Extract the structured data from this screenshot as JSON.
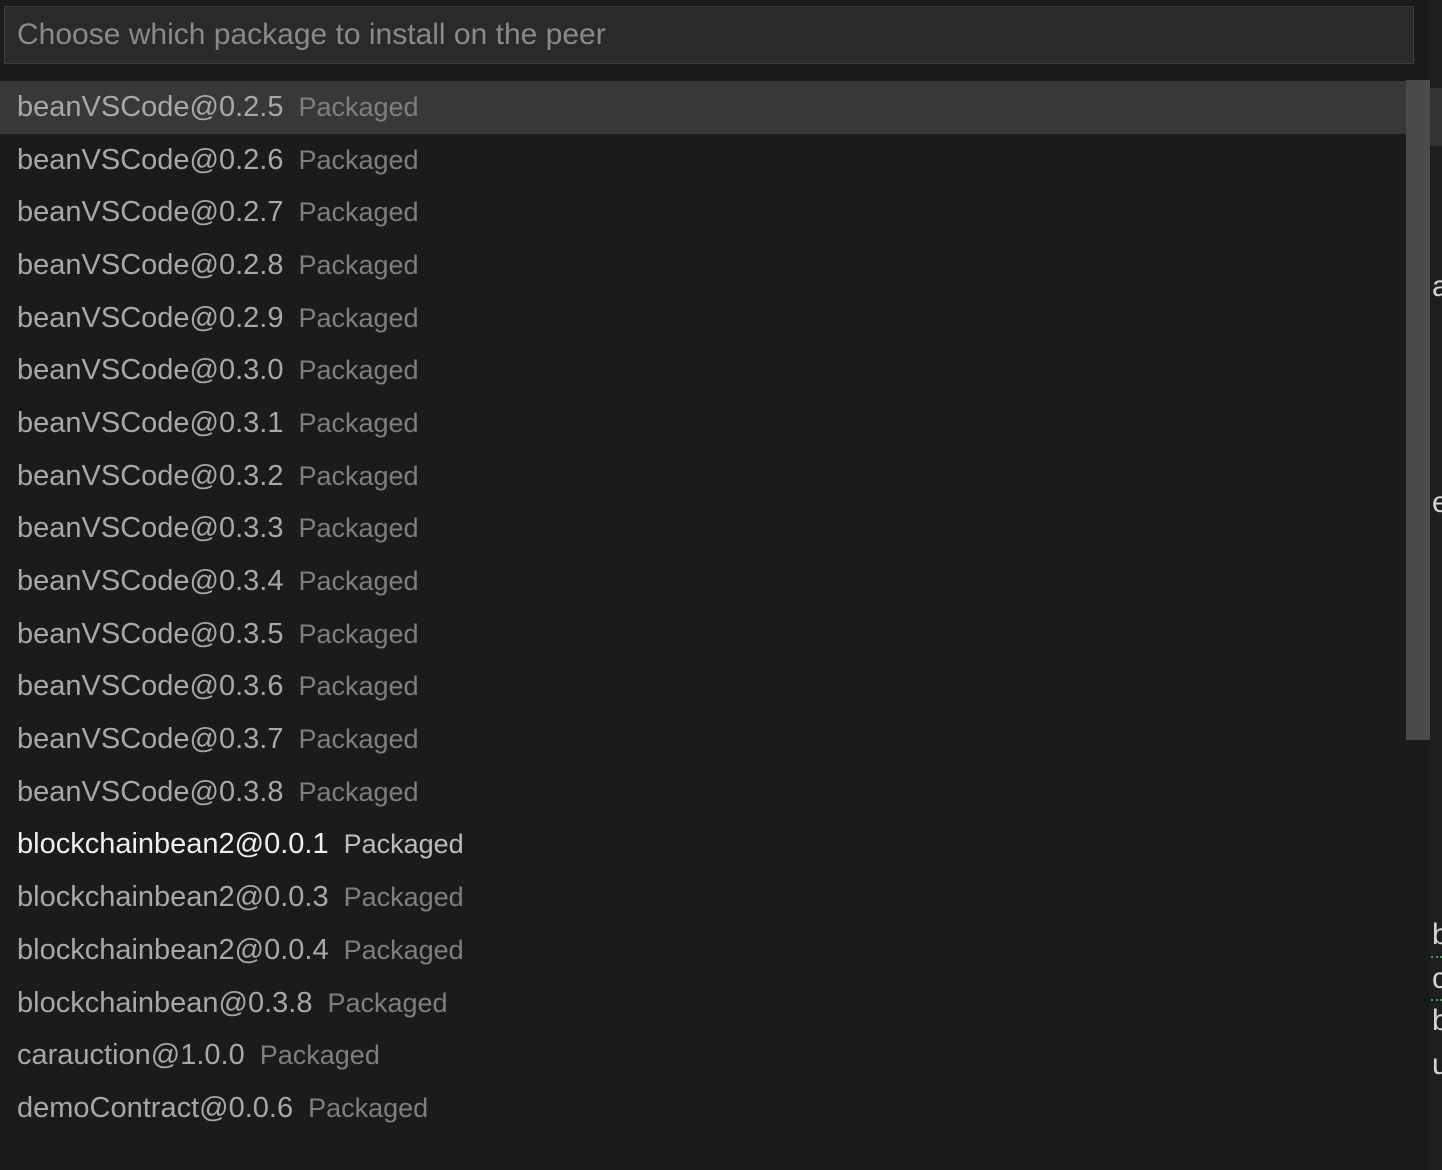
{
  "quick_pick": {
    "placeholder": "Choose which package to install on the peer",
    "value": "",
    "items": [
      {
        "label": "beanVSCode@0.2.5",
        "description": "Packaged"
      },
      {
        "label": "beanVSCode@0.2.6",
        "description": "Packaged"
      },
      {
        "label": "beanVSCode@0.2.7",
        "description": "Packaged"
      },
      {
        "label": "beanVSCode@0.2.8",
        "description": "Packaged"
      },
      {
        "label": "beanVSCode@0.2.9",
        "description": "Packaged"
      },
      {
        "label": "beanVSCode@0.3.0",
        "description": "Packaged"
      },
      {
        "label": "beanVSCode@0.3.1",
        "description": "Packaged"
      },
      {
        "label": "beanVSCode@0.3.2",
        "description": "Packaged"
      },
      {
        "label": "beanVSCode@0.3.3",
        "description": "Packaged"
      },
      {
        "label": "beanVSCode@0.3.4",
        "description": "Packaged"
      },
      {
        "label": "beanVSCode@0.3.5",
        "description": "Packaged"
      },
      {
        "label": "beanVSCode@0.3.6",
        "description": "Packaged"
      },
      {
        "label": "beanVSCode@0.3.7",
        "description": "Packaged"
      },
      {
        "label": "beanVSCode@0.3.8",
        "description": "Packaged"
      },
      {
        "label": "blockchainbean2@0.0.1",
        "description": "Packaged"
      },
      {
        "label": "blockchainbean2@0.0.3",
        "description": "Packaged"
      },
      {
        "label": "blockchainbean2@0.0.4",
        "description": "Packaged"
      },
      {
        "label": "blockchainbean@0.3.8",
        "description": "Packaged"
      },
      {
        "label": "carauction@1.0.0",
        "description": "Packaged"
      },
      {
        "label": "demoContract@0.0.6",
        "description": "Packaged"
      }
    ]
  },
  "background_editor": {
    "visible_chars": [
      "a",
      "e",
      "b",
      "c",
      "b",
      "u"
    ]
  },
  "colors": {
    "background": "#1b1b1b",
    "selected_row": "#383838",
    "label": "#a8a8a8",
    "label_highlight": "#f0f0f0",
    "description": "#7f7f7f",
    "scrollbar": "#4a4a4a",
    "squiggle": "#3fa34d"
  }
}
